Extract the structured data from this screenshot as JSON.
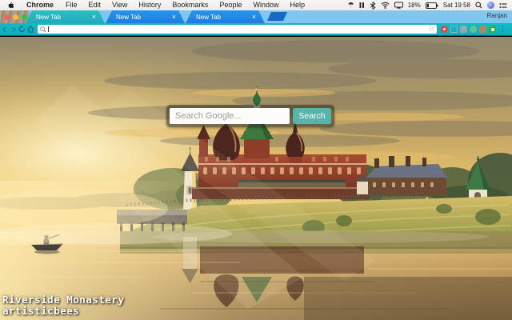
{
  "menu_bar": {
    "menus": [
      "Chrome",
      "File",
      "Edit",
      "View",
      "History",
      "Bookmarks",
      "People",
      "Window",
      "Help"
    ],
    "status": {
      "battery_percent": "18%",
      "clock": "Sat 19:58",
      "umbrella_glyph": "☂"
    }
  },
  "tab_bar": {
    "tabs": [
      {
        "title": "New Tab",
        "state": "active"
      },
      {
        "title": "New Tab",
        "state": "inactive"
      },
      {
        "title": "New Tab",
        "state": "inactive"
      }
    ],
    "close_glyph": "×",
    "profile_name": "Ranjan"
  },
  "toolbar": {
    "star_glyph": "☆",
    "menu_glyph": "⋮"
  },
  "ntp": {
    "search_placeholder": "Search Google...",
    "search_button_label": "Search",
    "credit_title": "Riverside Monastery",
    "credit_author": "artisticbees"
  },
  "theme_colors": {
    "frame_blue": "#7fc6f0",
    "inactive_tab_blue": "#1d87e4",
    "active_tab_teal": "#25b2ba",
    "toolbar_teal": "#12b2c2",
    "search_button_teal": "#57b4ab",
    "new_tab_button_blue": "#1668c7"
  }
}
